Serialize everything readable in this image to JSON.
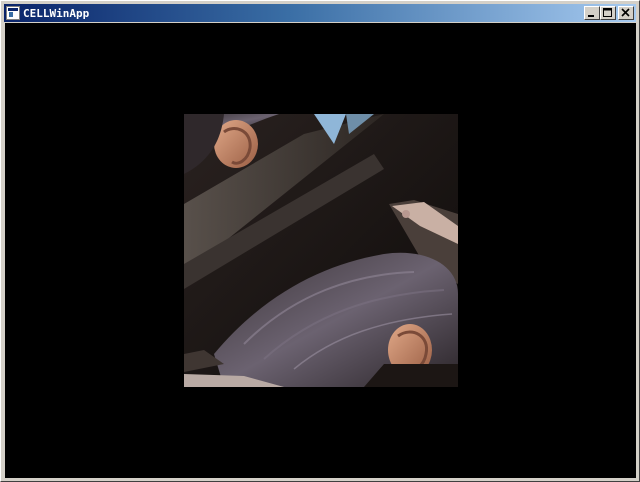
{
  "window": {
    "title": "CELLWinApp",
    "icon": "application-window-icon",
    "controls": [
      "minimize-icon",
      "maximize-icon",
      "close-icon"
    ]
  },
  "viewport": {
    "background": "#000000",
    "content": "rendered-quad-texture"
  }
}
